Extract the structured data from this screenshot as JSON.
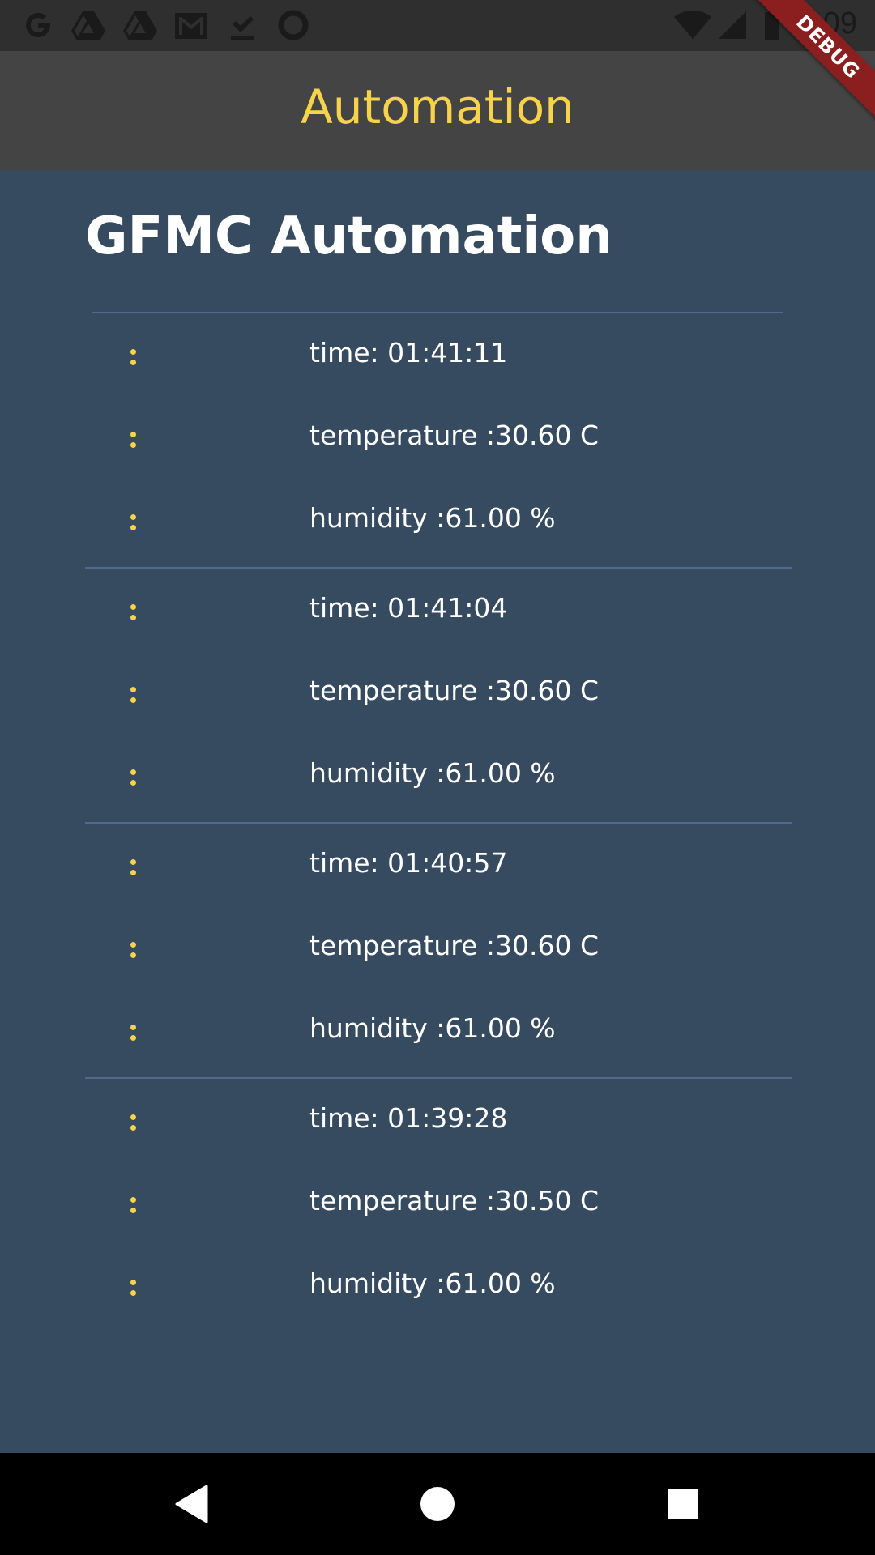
{
  "status_bar": {
    "time": "2:09",
    "left_icons": [
      "google-icon",
      "drive-icon",
      "drive-icon",
      "gmail-icon",
      "download-done-icon",
      "circle-icon"
    ],
    "right_icons": [
      "wifi-icon",
      "signal-icon",
      "battery-icon"
    ]
  },
  "debug_banner": {
    "label": "DEBUG",
    "color": "#8b1f1f"
  },
  "app_bar": {
    "title": "Automation",
    "title_color": "#f6d34a",
    "background": "#444444"
  },
  "page": {
    "heading": "GFMC Automation",
    "background": "#364a60"
  },
  "readings": [
    {
      "time": "time: 01:41:11",
      "temperature": "temperature :30.60 C",
      "humidity": "humidity :61.00 %"
    },
    {
      "time": "time: 01:41:04",
      "temperature": "temperature :30.60 C",
      "humidity": "humidity :61.00 %"
    },
    {
      "time": "time: 01:40:57",
      "temperature": "temperature :30.60 C",
      "humidity": "humidity :61.00 %"
    },
    {
      "time": "time: 01:39:28",
      "temperature": "temperature :30.50 C",
      "humidity": "humidity :61.00 %"
    }
  ],
  "nav_bar": {
    "buttons": [
      "back-icon",
      "home-icon",
      "recents-icon"
    ]
  }
}
